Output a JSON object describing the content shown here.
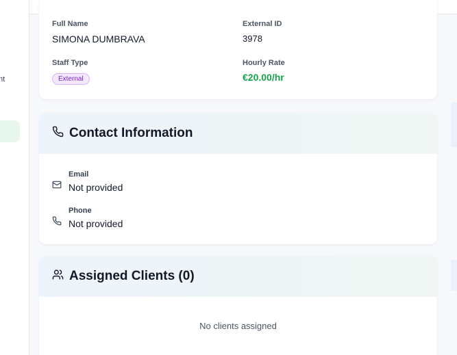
{
  "sidebar": {
    "partial_label": "nt"
  },
  "details": {
    "full_name_label": "Full Name",
    "full_name": "SIMONA DUMBRAVA",
    "external_id_label": "External ID",
    "external_id": "3978",
    "staff_type_label": "Staff Type",
    "staff_type": "External",
    "hourly_rate_label": "Hourly Rate",
    "hourly_rate": "€20.00/hr"
  },
  "contact": {
    "title": "Contact Information",
    "email_label": "Email",
    "email_value": "Not provided",
    "phone_label": "Phone",
    "phone_value": "Not provided"
  },
  "clients": {
    "title": "Assigned Clients (0)",
    "empty_text": "No clients assigned"
  },
  "colors": {
    "accent_green": "#16a34a",
    "badge_purple": "#7e22ce",
    "header_gradient_start": "#eef4fb",
    "header_gradient_end": "#eff6f3"
  },
  "icons": {
    "contact_header": "phone-icon",
    "email": "mail-icon",
    "phone": "phone-icon",
    "clients_header": "users-icon"
  }
}
